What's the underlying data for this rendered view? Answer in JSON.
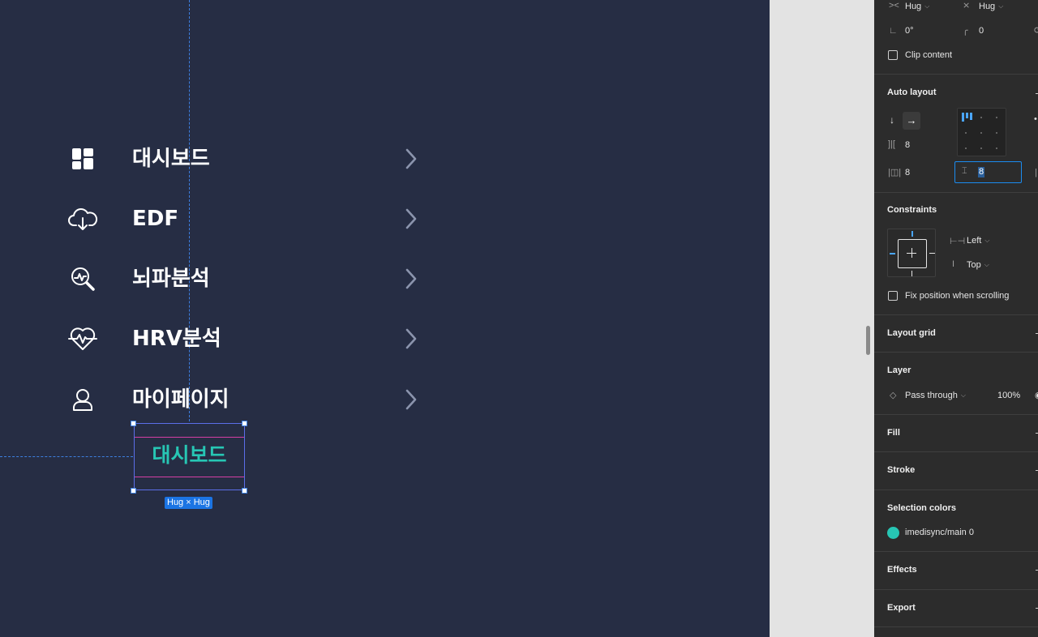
{
  "canvas": {
    "menu": [
      {
        "label": "대시보드",
        "icon": "dashboard-grid-icon"
      },
      {
        "label": "EDF",
        "icon": "cloud-download-icon"
      },
      {
        "label": "뇌파분석",
        "icon": "analysis-magnifier-icon"
      },
      {
        "label": "HRV분석",
        "icon": "heart-pulse-icon"
      },
      {
        "label": "마이페이지",
        "icon": "user-icon"
      }
    ],
    "selected_label": "대시보드",
    "size_badge": "Hug × Hug",
    "colors": {
      "background": "#262d44",
      "accent": "#27c6b4",
      "chevron": "#8b94ad"
    }
  },
  "panel": {
    "size": {
      "width_mode": "Hug",
      "height_mode": "Hug",
      "rotation": "0°",
      "corner_radius": "0"
    },
    "clip_content": {
      "label": "Clip content",
      "checked": false
    },
    "auto_layout": {
      "title": "Auto layout",
      "direction": "horizontal",
      "spacing": "8",
      "horizontal_padding": "8",
      "vertical_padding": "8"
    },
    "constraints": {
      "title": "Constraints",
      "horizontal": "Left",
      "vertical": "Top",
      "fix_position_label": "Fix position when scrolling",
      "fix_position_checked": false
    },
    "layout_grid": "Layout grid",
    "layer": {
      "title": "Layer",
      "blend_mode": "Pass through",
      "opacity": "100%"
    },
    "fill": "Fill",
    "stroke": "Stroke",
    "selection_colors": {
      "title": "Selection colors",
      "items": [
        {
          "name": "imedisync/main 0",
          "color": "#27c6b4"
        }
      ]
    },
    "effects": "Effects",
    "export": "Export"
  }
}
